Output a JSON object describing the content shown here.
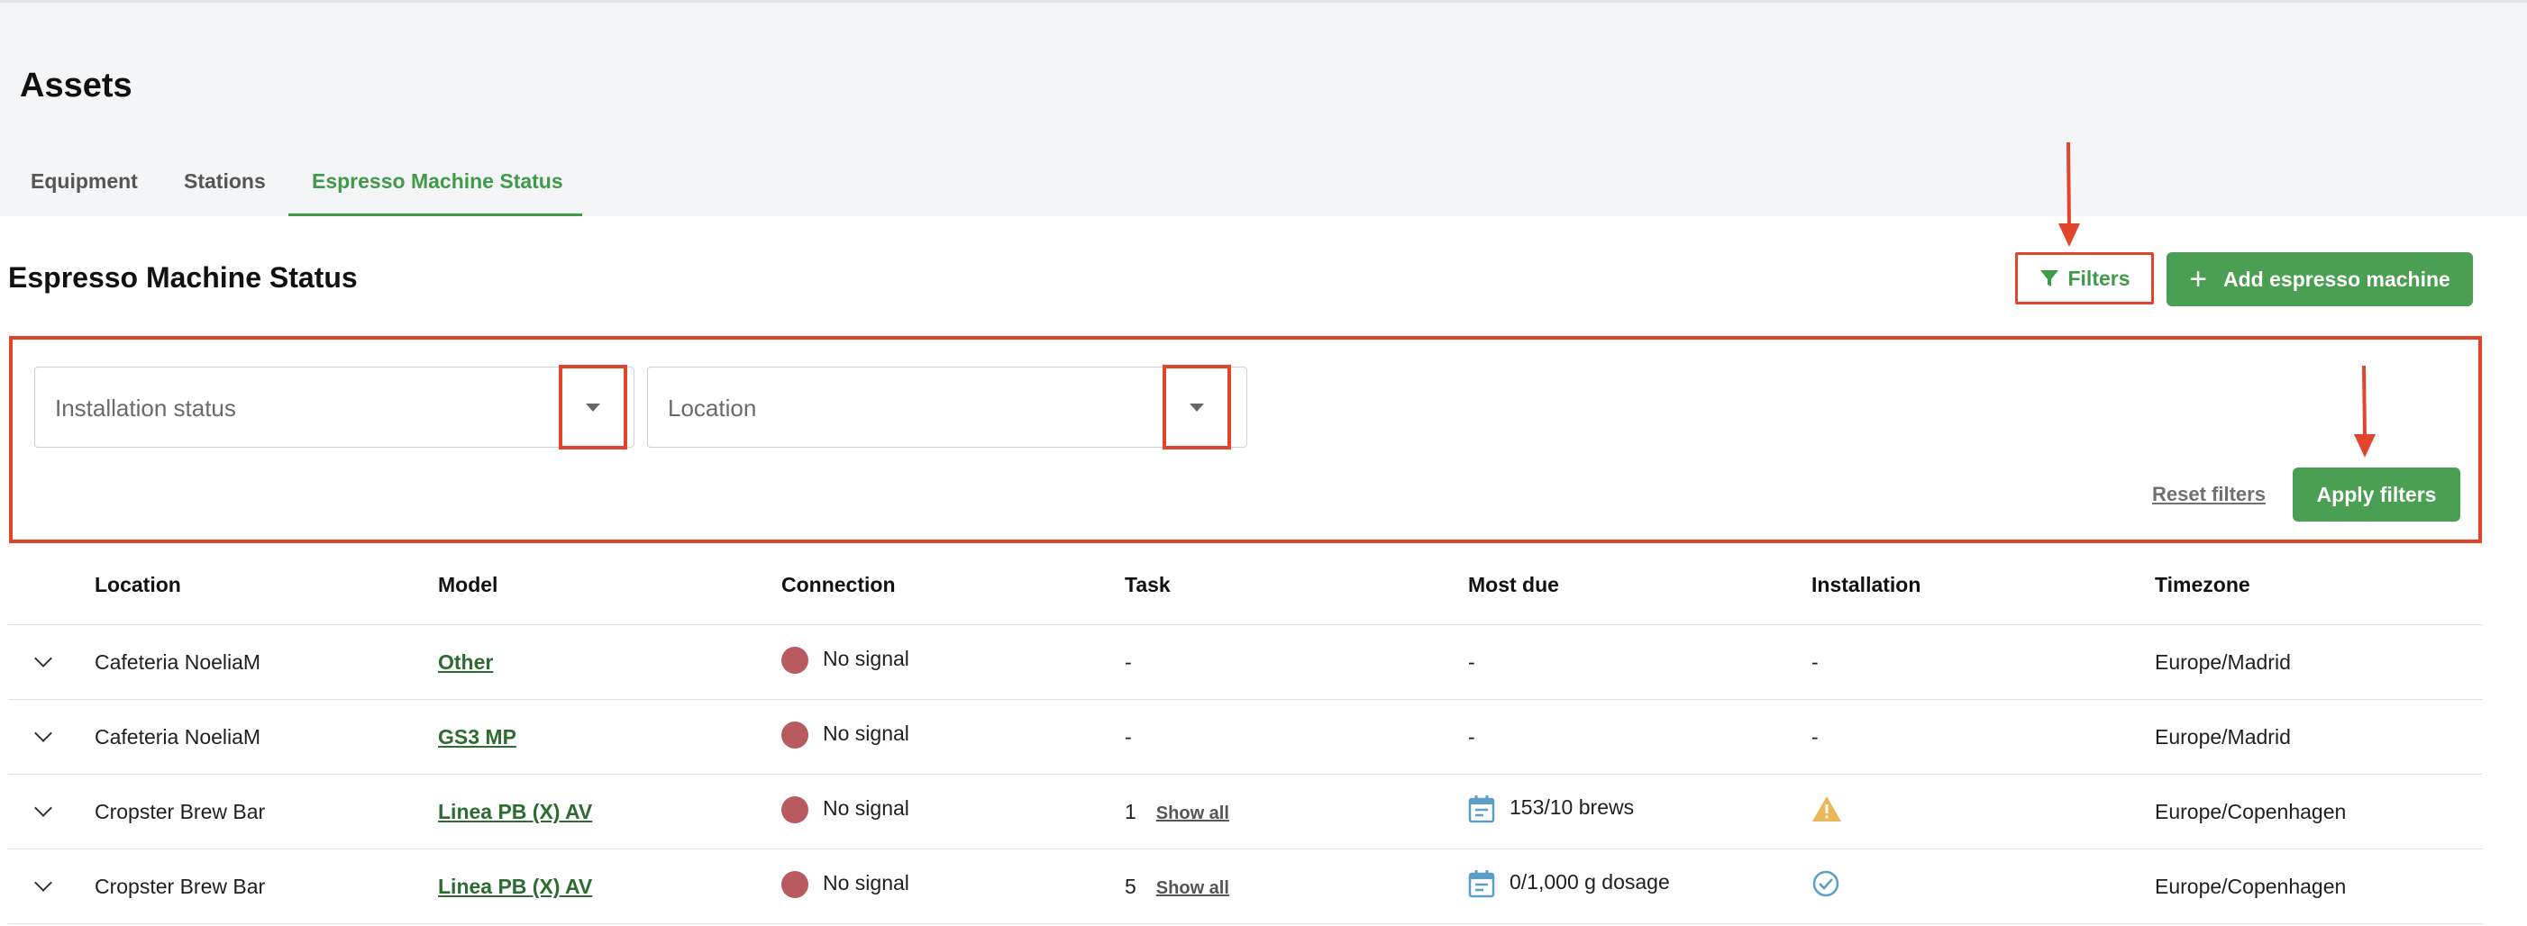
{
  "page": {
    "title": "Assets"
  },
  "tabs": [
    {
      "label": "Equipment"
    },
    {
      "label": "Stations"
    },
    {
      "label": "Espresso Machine Status",
      "active": true
    }
  ],
  "section": {
    "title": "Espresso Machine Status"
  },
  "toolbar": {
    "filters_label": "Filters",
    "add_label": "Add espresso machine"
  },
  "filters": {
    "installation_status_placeholder": "Installation status",
    "location_placeholder": "Location",
    "reset_label": "Reset filters",
    "apply_label": "Apply filters"
  },
  "table": {
    "columns": [
      "Location",
      "Model",
      "Connection",
      "Task",
      "Most due",
      "Installation",
      "Timezone"
    ],
    "rows": [
      {
        "location": "Cafeteria NoeliaM",
        "model": "Other",
        "connection": "No signal",
        "task": "-",
        "task_link": "",
        "most_due": "-",
        "most_due_icon": "",
        "installation": "-",
        "installation_icon": "",
        "timezone": "Europe/Madrid"
      },
      {
        "location": "Cafeteria NoeliaM",
        "model": "GS3 MP",
        "connection": "No signal",
        "task": "-",
        "task_link": "",
        "most_due": "-",
        "most_due_icon": "",
        "installation": "-",
        "installation_icon": "",
        "timezone": "Europe/Madrid"
      },
      {
        "location": "Cropster Brew Bar",
        "model": "Linea PB (X) AV",
        "connection": "No signal",
        "task": "1",
        "task_link": "Show all",
        "most_due": "153/10 brews",
        "most_due_icon": "calendar-icon",
        "installation": "",
        "installation_icon": "warning-icon",
        "timezone": "Europe/Copenhagen"
      },
      {
        "location": "Cropster Brew Bar",
        "model": "Linea PB (X) AV",
        "connection": "No signal",
        "task": "5",
        "task_link": "Show all",
        "most_due": "0/1,000 g dosage",
        "most_due_icon": "calendar-icon",
        "installation": "",
        "installation_icon": "check-circle-icon",
        "timezone": "Europe/Copenhagen"
      }
    ]
  },
  "colors": {
    "accent_green": "#4a9f52",
    "annotation_red": "#e2452d",
    "status_dot": "#b85a60"
  }
}
